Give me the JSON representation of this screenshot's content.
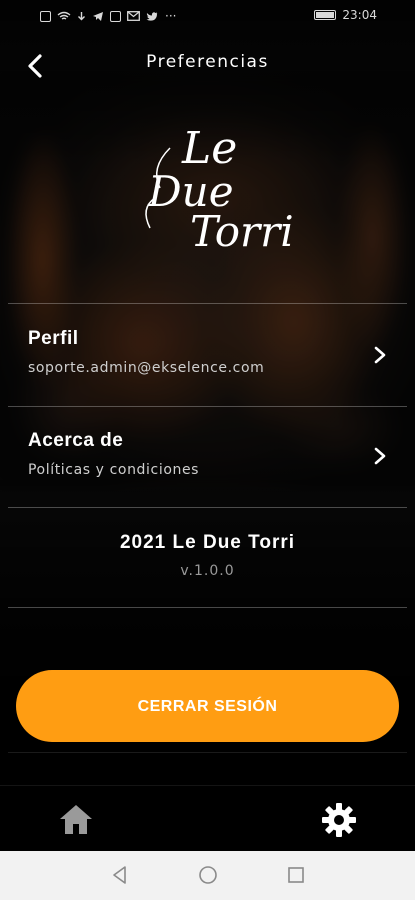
{
  "status_bar": {
    "time": "23:04",
    "more": "···"
  },
  "header": {
    "title": "Preferencias"
  },
  "logo": {
    "lines": [
      "Le",
      "Due",
      "Torri"
    ]
  },
  "menu": [
    {
      "title": "Perfil",
      "subtitle": "soporte.admin@ekselence.com"
    },
    {
      "title": "Acerca de",
      "subtitle": "Políticas y condiciones"
    }
  ],
  "footer": {
    "title": "2021 Le Due Torri",
    "version": "v.1.0.0"
  },
  "logout": {
    "label": "CERRAR SESIÓN"
  },
  "colors": {
    "accent": "#ff9d12",
    "background": "#000000"
  },
  "tabs": [
    {
      "name": "home",
      "icon": "home-icon"
    },
    {
      "name": "settings",
      "icon": "gear-icon"
    }
  ]
}
